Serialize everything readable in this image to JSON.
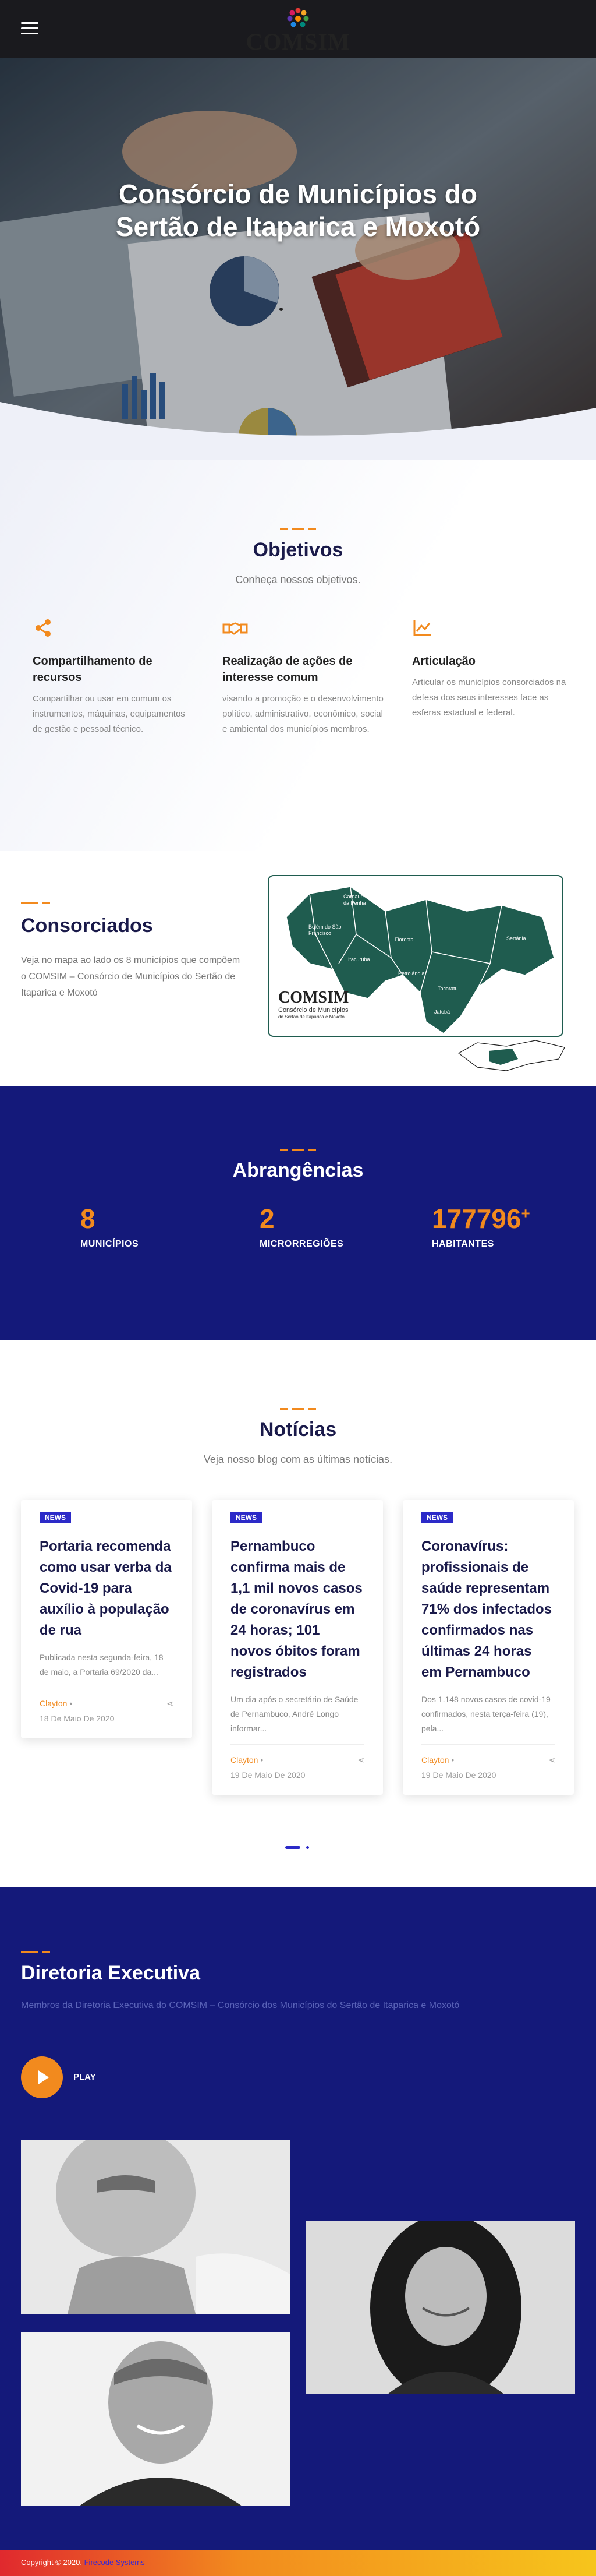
{
  "header": {
    "brand": "COMSIM",
    "menu_icon": "hamburger-icon"
  },
  "hero": {
    "title": "Consórcio de Municípios do Sertão de Itaparica e Moxotó"
  },
  "objetivos": {
    "title": "Objetivos",
    "subtitle": "Conheça nossos objetivos.",
    "items": [
      {
        "icon": "share-icon",
        "title": "Compartilhamento de recursos",
        "desc": "Compartilhar ou usar em comum os instrumentos, máquinas, equipamentos de gestão e pessoal técnico."
      },
      {
        "icon": "handshake-icon",
        "title": "Realização de ações de interesse comum",
        "desc": "visando a promoção e o desenvolvimento político, administrativo, econômico, social e ambiental dos municípios membros."
      },
      {
        "icon": "chart-icon",
        "title": "Articulação",
        "desc": "Articular os municípios consorciados na defesa dos seus interesses face as esferas estadual e federal."
      }
    ]
  },
  "consorciados": {
    "title": "Consorciados",
    "desc": "Veja no mapa ao lado os 8 municípios que compõem o COMSIM – Consórcio de Municípios do Sertão de Itaparica e Moxotó",
    "map": {
      "municipios": [
        "Carnaubeira da Penha",
        "Belém do São Francisco",
        "Floresta",
        "Itacuruba",
        "Petrolândia",
        "Tacaratu",
        "Jatobá",
        "Sertânia"
      ],
      "logo_brand": "COMSIM",
      "logo_sub": "Consórcio de Municípios",
      "logo_sub2": "do Sertão de Itaparica e Moxotó"
    }
  },
  "abrangencias": {
    "title": "Abrangências",
    "stats": [
      {
        "value": "8",
        "label": "MUNICÍPIOS"
      },
      {
        "value": "2",
        "label": "MICRORREGIÕES"
      },
      {
        "value": "177796",
        "suffix": "+",
        "label": "HABITANTES"
      }
    ]
  },
  "noticias": {
    "title": "Notícias",
    "subtitle": "Veja nosso blog com as últimas notícias.",
    "cards": [
      {
        "badge": "NEWS",
        "title": "Portaria recomenda como usar verba da Covid-19 para auxílio à população de rua",
        "desc": "Publicada nesta segunda-feira, 18 de maio, a Portaria 69/2020 da...",
        "author": "Clayton",
        "date": "18 De Maio De 2020"
      },
      {
        "badge": "NEWS",
        "title": "Pernambuco confirma mais de 1,1 mil novos casos de coronavírus em 24 horas; 101 novos óbitos foram registrados",
        "desc": "Um dia após o secretário de Saúde de Pernambuco, André Longo informar...",
        "author": "Clayton",
        "date": "19 De Maio De 2020"
      },
      {
        "badge": "NEWS",
        "title": "Coronavírus: profissionais de saúde representam 71% dos infectados confirmados nas últimas 24 horas em Pernambuco",
        "desc": "Dos 1.148 novos casos de covid-19 confirmados, nesta terça-feira (19), pela...",
        "author": "Clayton",
        "date": "19 De Maio De 2020"
      }
    ]
  },
  "diretoria": {
    "title": "Diretoria Executiva",
    "subtitle": "Membros da Diretoria Executiva do COMSIM – Consórcio dos Municípios do Sertão de Itaparica e Moxotó",
    "play_label": "PLAY"
  },
  "footer": {
    "prefix": "Copyright © 2020.",
    "link": "Firecode Systems"
  },
  "colors": {
    "navy": "#14197a",
    "orange": "#f28a1e",
    "badge": "#2c2ac8",
    "map_green": "#1f5c4f"
  }
}
